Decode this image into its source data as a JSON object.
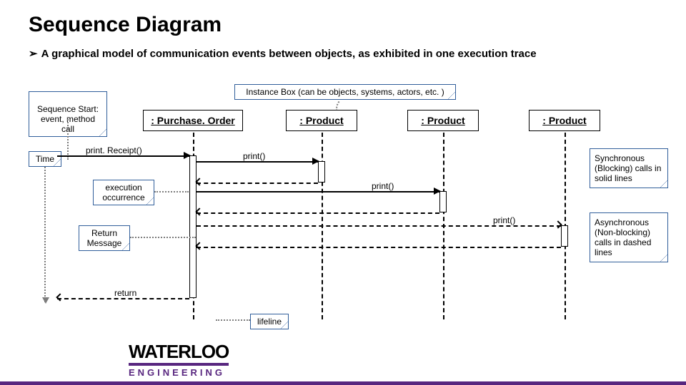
{
  "title": "Sequence Diagram",
  "bullet": "A graphical model of communication events between objects, as exhibited in one execution trace",
  "labels": {
    "instance_box": "Instance Box (can be objects, systems, actors, etc. )",
    "seq_start": "Sequence Start:\nevent, method call",
    "time": "Time",
    "exec_occ": "execution\noccurrence",
    "return_msg": "Return\nMessage",
    "lifeline": "lifeline",
    "sync": "Synchronous (Blocking) calls in solid lines",
    "async": "Asynchronous (Non-blocking) calls in dashed lines"
  },
  "lifelines": {
    "po": ": Purchase. Order",
    "p1": ": Product",
    "p2": ": Product",
    "p3": ": Product"
  },
  "messages": {
    "m1": "print. Receipt()",
    "m2": "print()",
    "m3": "print()",
    "m4": "print()",
    "ret": "return"
  },
  "logo": {
    "word": "WATERLOO",
    "sub": "ENGINEERING"
  }
}
